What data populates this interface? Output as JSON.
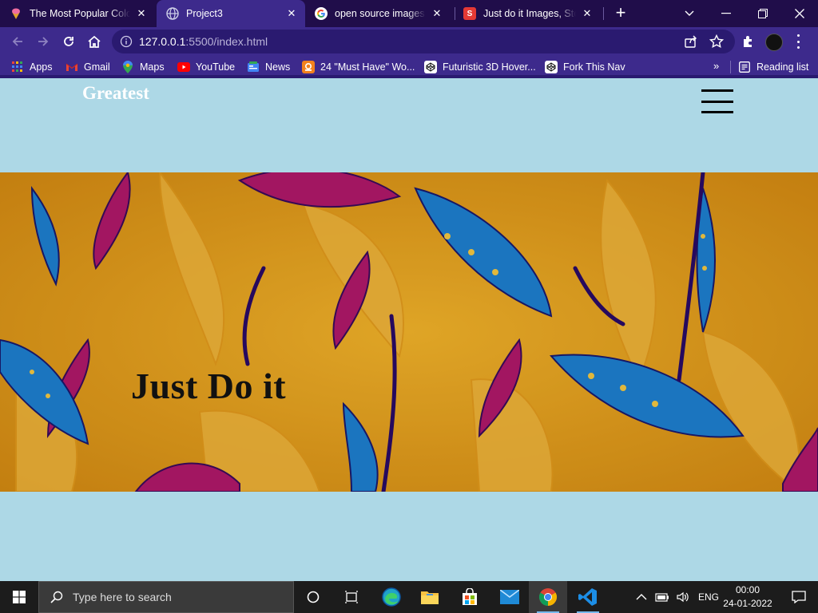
{
  "browser": {
    "tabs": [
      {
        "title": "The Most Popular Colo",
        "favicon": "ice-cream-icon"
      },
      {
        "title": "Project3",
        "favicon": "globe-icon",
        "active": true
      },
      {
        "title": "open source images ju",
        "favicon": "google-icon"
      },
      {
        "title": "Just do it Images, Stock",
        "favicon": "red-s-icon"
      }
    ],
    "new_tab_label": "+",
    "url_host": "127.0.0.1",
    "url_rest": ":5500/index.html",
    "bookmarks": [
      {
        "label": "Apps",
        "icon": "apps-grid-icon"
      },
      {
        "label": "Gmail",
        "icon": "gmail-icon"
      },
      {
        "label": "Maps",
        "icon": "maps-icon"
      },
      {
        "label": "YouTube",
        "icon": "youtube-icon"
      },
      {
        "label": "News",
        "icon": "news-icon"
      },
      {
        "label": "24 \"Must Have\" Wo...",
        "icon": "orange-icon"
      },
      {
        "label": "Futuristic 3D Hover...",
        "icon": "codepen-icon"
      },
      {
        "label": "Fork This Nav",
        "icon": "codepen-icon"
      }
    ],
    "bookmarks_more": "»",
    "reading_list": "Reading list"
  },
  "page": {
    "brand": "Greatest",
    "hero_title": "Just Do it"
  },
  "taskbar": {
    "search_placeholder": "Type here to search",
    "language": "ENG",
    "time": "00:00",
    "date": "24-01-2022"
  },
  "colors": {
    "tabstrip": "#200d4a",
    "toolbar": "#3d2a8c",
    "page_bg": "#add8e6",
    "hero_base": "#e8a51c"
  }
}
